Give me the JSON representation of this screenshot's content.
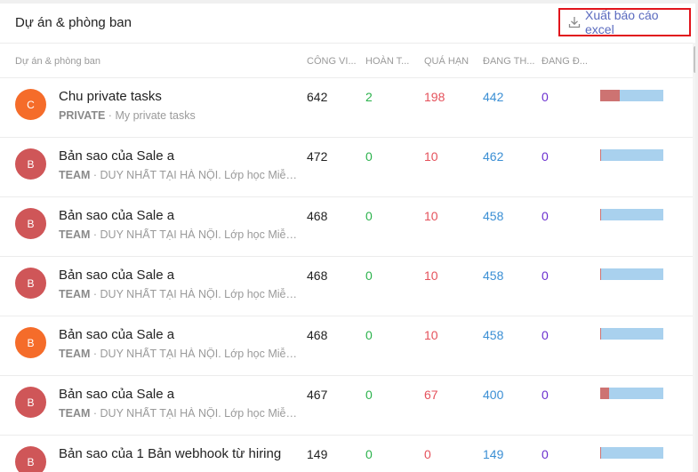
{
  "header": {
    "title": "Dự án & phòng ban",
    "export_label": "Xuất báo cáo excel",
    "export_icon": "download-icon"
  },
  "columns": {
    "project": "Dự án & phòng ban",
    "total": "CÔNG VI...",
    "done": "HOÀN T...",
    "overdue": "QUÁ HẠN",
    "in_progress": "ĐANG TH...",
    "waiting": "ĐANG Đ..."
  },
  "colors": {
    "done": "#2bb24c",
    "overdue": "#e5525c",
    "in_progress": "#3b8fd4",
    "waiting": "#6b2fcf",
    "export_border": "#e1141c",
    "avatar_orange": "#f56c2a",
    "avatar_red": "#cf5658"
  },
  "rows": [
    {
      "avatar": "C",
      "avatar_color": "#f56c2a",
      "name": "Chu private tasks",
      "kind": "PRIVATE",
      "desc": "My private tasks",
      "total": "642",
      "done": "2",
      "overdue": "198",
      "in_progress": "442",
      "waiting": "0",
      "overdue_frac": 0.308,
      "done_frac": 0.003
    },
    {
      "avatar": "B",
      "avatar_color": "#cf5658",
      "name": "Bản sao của Sale a",
      "kind": "TEAM",
      "desc": "DUY NHẤT TẠI HÀ NỘI. Lớp học Miễn phí",
      "total": "472",
      "done": "0",
      "overdue": "10",
      "in_progress": "462",
      "waiting": "0",
      "overdue_frac": 0.021,
      "done_frac": 0
    },
    {
      "avatar": "B",
      "avatar_color": "#cf5658",
      "name": "Bản sao của Sale a",
      "kind": "TEAM",
      "desc": "DUY NHẤT TẠI HÀ NỘI. Lớp học Miễn phí",
      "total": "468",
      "done": "0",
      "overdue": "10",
      "in_progress": "458",
      "waiting": "0",
      "overdue_frac": 0.021,
      "done_frac": 0
    },
    {
      "avatar": "B",
      "avatar_color": "#cf5658",
      "name": "Bản sao của Sale a",
      "kind": "TEAM",
      "desc": "DUY NHẤT TẠI HÀ NỘI. Lớp học Miễn phí",
      "total": "468",
      "done": "0",
      "overdue": "10",
      "in_progress": "458",
      "waiting": "0",
      "overdue_frac": 0.021,
      "done_frac": 0
    },
    {
      "avatar": "B",
      "avatar_color": "#f56c2a",
      "name": "Bản sao của Sale a",
      "kind": "TEAM",
      "desc": "DUY NHẤT TẠI HÀ NỘI. Lớp học Miễn phí",
      "total": "468",
      "done": "0",
      "overdue": "10",
      "in_progress": "458",
      "waiting": "0",
      "overdue_frac": 0.021,
      "done_frac": 0
    },
    {
      "avatar": "B",
      "avatar_color": "#cf5658",
      "name": "Bản sao của Sale a",
      "kind": "TEAM",
      "desc": "DUY NHẤT TẠI HÀ NỘI. Lớp học Miễn phí",
      "total": "467",
      "done": "0",
      "overdue": "67",
      "in_progress": "400",
      "waiting": "0",
      "overdue_frac": 0.143,
      "done_frac": 0
    },
    {
      "avatar": "B",
      "avatar_color": "#cf5658",
      "name": "Bản sao của 1 Bản webhook từ hiring",
      "kind": "",
      "desc": "",
      "total": "149",
      "done": "0",
      "overdue": "0",
      "in_progress": "149",
      "waiting": "0",
      "overdue_frac": 0,
      "done_frac": 0
    }
  ]
}
